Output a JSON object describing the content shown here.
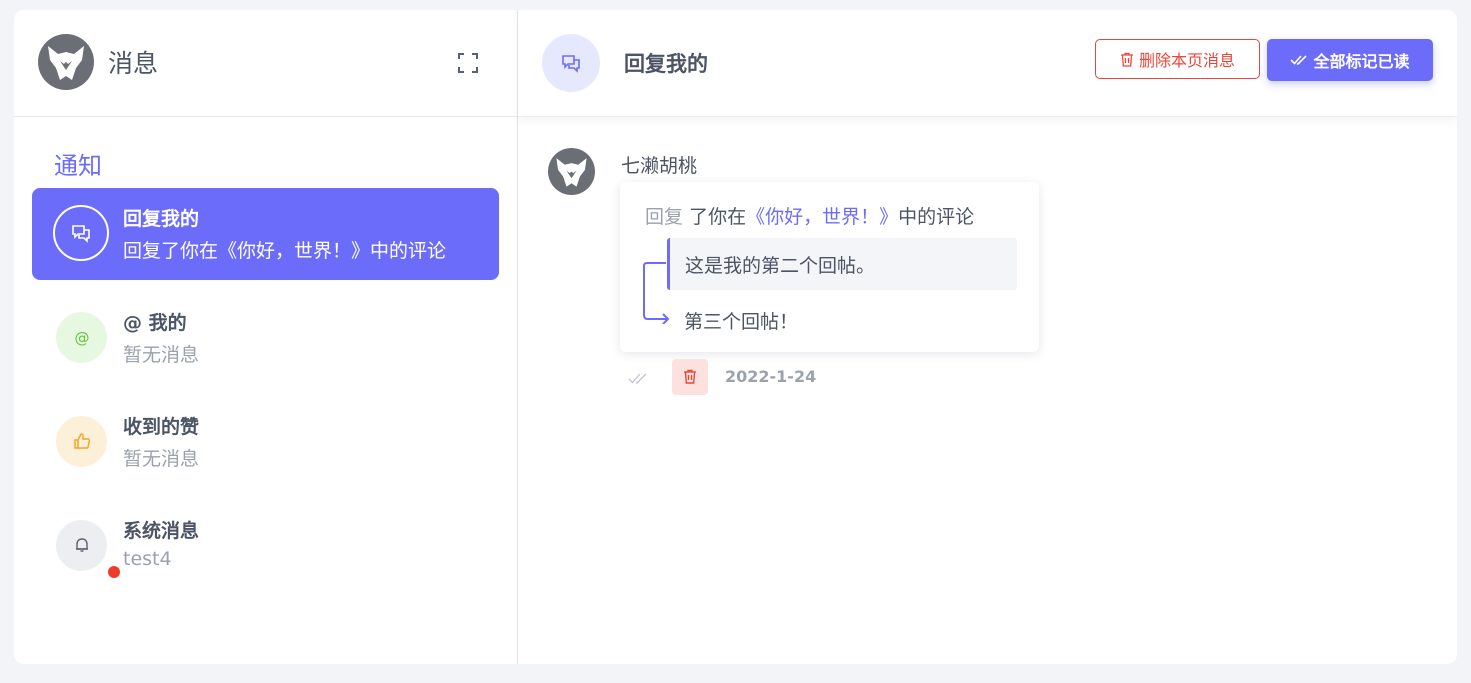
{
  "sidebar": {
    "title": "消息",
    "section_label": "通知",
    "items": [
      {
        "name": "回复我的",
        "sub": "回复了你在《你好，世界！》中的评论",
        "icon": "chat-icon",
        "icon_bg": "#ffffff",
        "active": true
      },
      {
        "name": "@ 我的",
        "sub": "暂无消息",
        "icon": "at-icon",
        "icon_bg": "#e6f8e0"
      },
      {
        "name": "收到的赞",
        "sub": "暂无消息",
        "icon": "thumbs-up-icon",
        "icon_bg": "#fdf0d8"
      },
      {
        "name": "系统消息",
        "sub": "test4",
        "icon": "bell-icon",
        "icon_bg": "#eceef1",
        "unread_dot": true
      }
    ]
  },
  "header": {
    "title": "回复我的",
    "delete_label": "删除本页消息",
    "read_all_label": "全部标记已读"
  },
  "reply": {
    "user": "七濑胡桃",
    "prefix": "回复",
    "middle": "了你在",
    "post_link": "《你好，世界！》",
    "suffix": "中的评论",
    "quoted": "这是我的第二个回帖。",
    "text": "第三个回帖！",
    "date": "2022-1-24"
  },
  "colors": {
    "accent": "#6c6cfb",
    "danger": "#e8463a",
    "unread": "#ef3c2a"
  }
}
